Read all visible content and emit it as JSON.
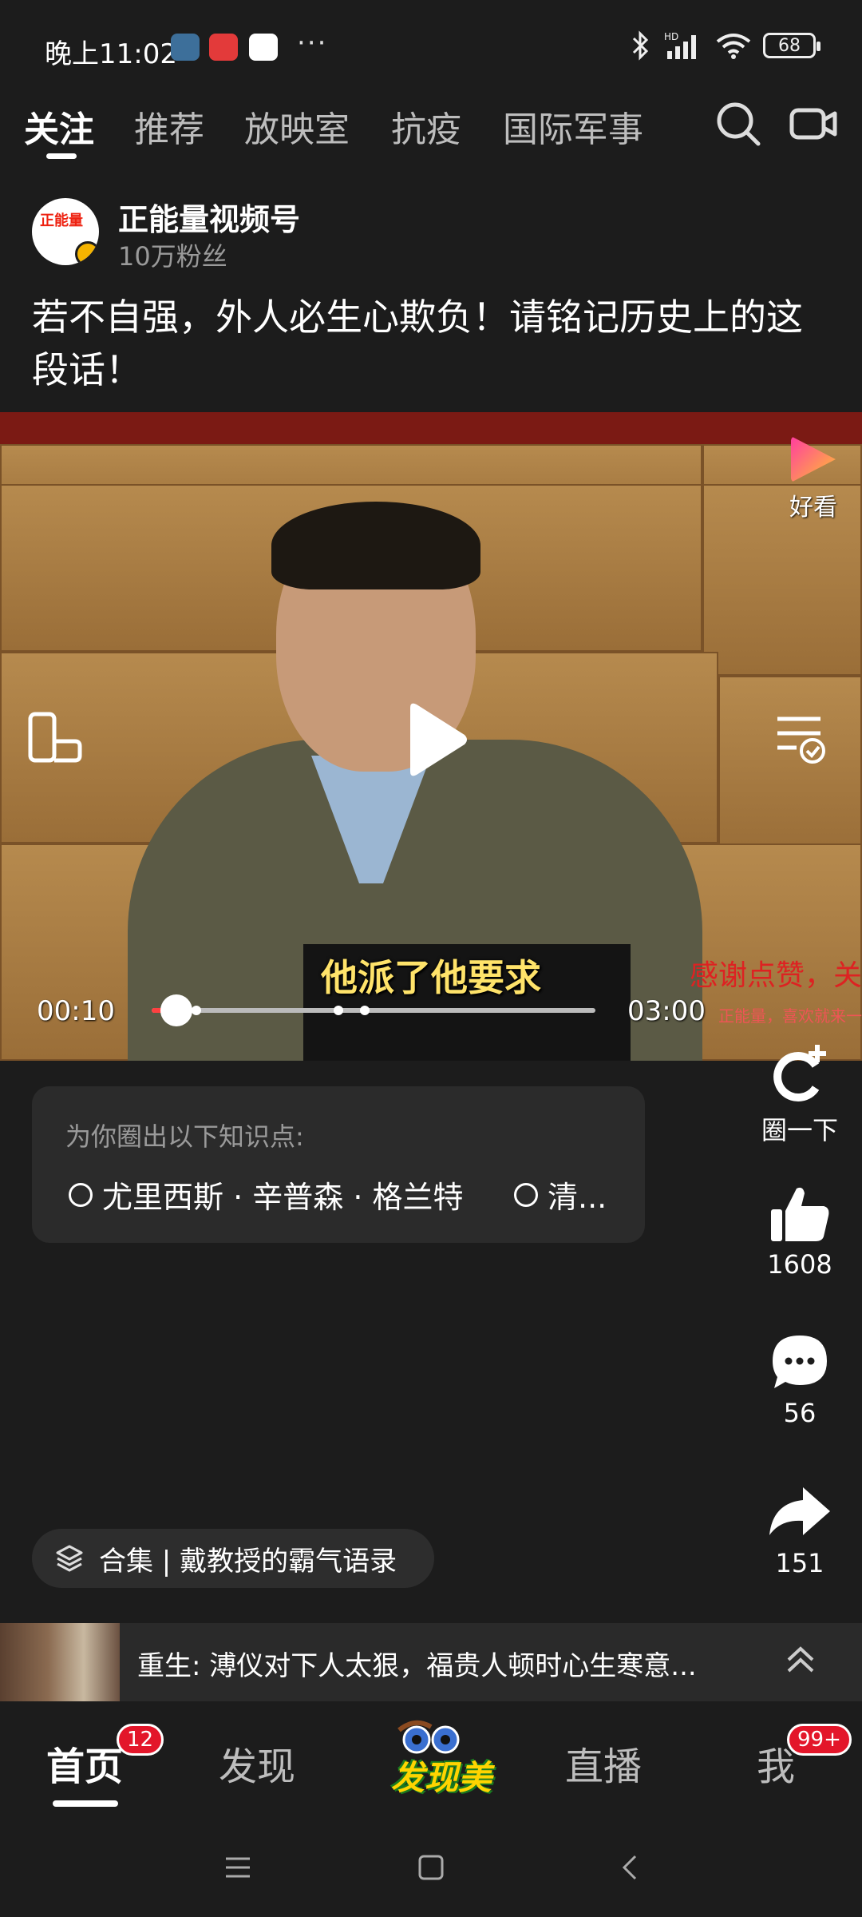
{
  "status_bar": {
    "time": "晚上11:02",
    "more": "···",
    "battery": "68"
  },
  "top_tabs": [
    "关注",
    "推荐",
    "放映室",
    "抗疫",
    "国际军事"
  ],
  "author": {
    "avatar_text": "正能量",
    "name": "正能量视频号",
    "fans": "10万粉丝"
  },
  "title": "若不自强，外人必生心欺负！请铭记历史上的这段话！",
  "video": {
    "subtitle": "他派了他要求",
    "watermark_line1": "感谢点赞，关",
    "watermark_line2": "正能量，喜欢就来一",
    "haokan_label": "好看",
    "current_time": "00:10",
    "total_time": "03:00",
    "progress": 0.055,
    "chapter_marks": [
      0.055,
      0.1,
      0.42,
      0.48
    ]
  },
  "knowledge": {
    "heading": "为你圈出以下知识点:",
    "items": [
      "尤里西斯 · 辛普森 · 格兰特",
      "清..."
    ]
  },
  "actions": {
    "circle_label": "圈一下",
    "likes": "1608",
    "comments": "56",
    "shares": "151"
  },
  "collection": "合集 | 戴教授的霸气语录",
  "next_video": "重生: 溥仪对下人太狠，福贵人顿时心生寒意...",
  "bottom_nav": {
    "home": "首页",
    "home_badge": "12",
    "discover": "发现",
    "discover_logo": "发现美",
    "live": "直播",
    "me": "我",
    "me_badge": "99+"
  }
}
